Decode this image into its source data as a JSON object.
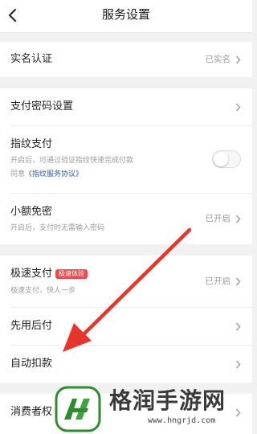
{
  "header": {
    "title": "服务设置",
    "back_icon": "chevron-left-icon"
  },
  "realname": {
    "title": "实名认证",
    "value": "已实名"
  },
  "pay": {
    "password": {
      "title": "支付密码设置"
    },
    "fingerprint": {
      "title": "指纹支付",
      "sub": "开启后，可通过验证指纹快速完成付款",
      "agree_prefix": "同意",
      "agree_link": "《指纹服务协议》",
      "enabled": false
    },
    "smallfree": {
      "title": "小额免密",
      "sub": "开启后，支付时无需输入密码",
      "value": "已开启"
    }
  },
  "speed": {
    "fast": {
      "title": "极速支付",
      "badge": "极速体验",
      "sub": "极速支付，快人一步",
      "value": "已开启"
    },
    "paylater": {
      "title": "先用后付"
    },
    "autodeduct": {
      "title": "自动扣款"
    }
  },
  "consumer": {
    "title": "消费者权"
  },
  "watermark": {
    "title": "格润手游网",
    "url": "www.hngrjd.com"
  },
  "colors": {
    "accent_red": "#f0484d",
    "arrow_red": "#e8352b",
    "link_blue": "#2f5d9a",
    "watermark_green": "#2e8b2e"
  }
}
